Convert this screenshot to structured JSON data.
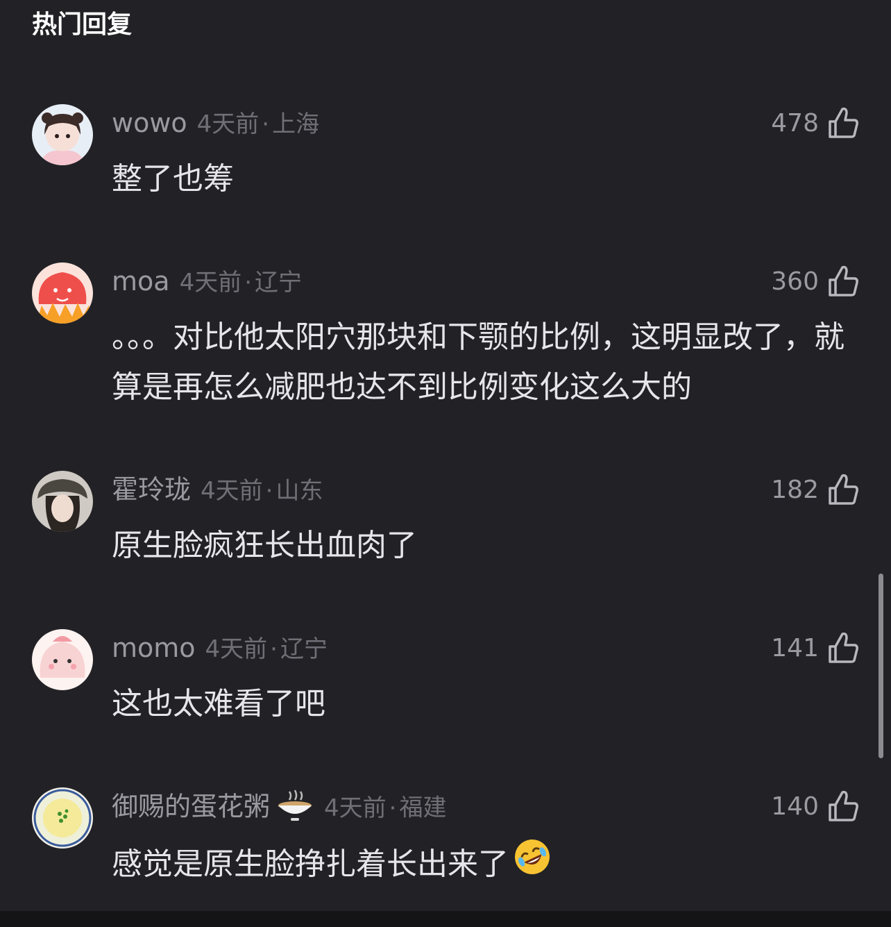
{
  "section_title": "热门回复",
  "comments": [
    {
      "name": "wowo",
      "time": "4天前",
      "location": "上海",
      "text": "整了也筹",
      "likes": "478"
    },
    {
      "name": "moa",
      "time": "4天前",
      "location": "辽宁",
      "text": "。。。对比他太阳穴那块和下颚的比例，这明显改了，就算是再怎么减肥也达不到比例变化这么大的",
      "likes": "360"
    },
    {
      "name": "霍玲珑",
      "time": "4天前",
      "location": "山东",
      "text": "原生脸疯狂长出血肉了",
      "likes": "182"
    },
    {
      "name": "momo",
      "time": "4天前",
      "location": "辽宁",
      "text": "这也太难看了吧",
      "likes": "141"
    },
    {
      "name": "御赐的蛋花粥",
      "time": "4天前",
      "location": "福建",
      "text": "感觉是原生脸挣扎着长出来了",
      "likes": "140"
    }
  ],
  "dot_sep": "·",
  "icons": {
    "like": "thumbs-up-icon",
    "name_emoji": "rice-bowl-icon",
    "text_emoji": "rolling-laughing-face-icon"
  },
  "colors": {
    "background": "#222226",
    "name": "#9a9aa0",
    "meta": "#6f6f75",
    "text": "#e6e6ea"
  }
}
